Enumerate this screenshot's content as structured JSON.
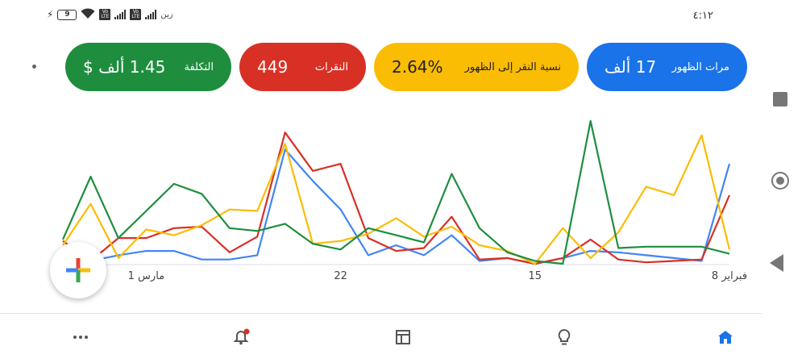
{
  "status_bar": {
    "battery_level": "9",
    "carrier": "زين",
    "time": "٤:١٢",
    "icons": [
      "charging-bolt-icon",
      "battery-icon",
      "wifi-icon",
      "volte-icon",
      "signal-icon"
    ]
  },
  "metric_cards": [
    {
      "id": "impressions",
      "label": "مرات الظهور",
      "value": "17 ألف",
      "color": "#1a73e8"
    },
    {
      "id": "ctr",
      "label": "نسبة النقر إلى الظهور",
      "value": "2.64%",
      "color": "#fbbc04"
    },
    {
      "id": "clicks",
      "label": "النقرات",
      "value": "449",
      "color": "#d93025"
    },
    {
      "id": "cost",
      "label": "التكلفة",
      "value": "1.45 ألف $",
      "color": "#1e8e3e"
    }
  ],
  "chart_data": {
    "type": "line",
    "x_labels": [
      {
        "label": "فبراير 8",
        "index": 0
      },
      {
        "label": "15",
        "index": 7
      },
      {
        "label": "22",
        "index": 14
      },
      {
        "label": "مارس 1",
        "index": 21
      }
    ],
    "ylim": [
      0,
      100
    ],
    "grid": false,
    "x_count": 25,
    "series": [
      {
        "color": "#4285f4",
        "values": [
          70,
          2,
          4,
          6,
          8,
          9,
          4,
          0,
          4,
          2,
          20,
          6,
          13,
          6,
          38,
          58,
          80,
          6,
          3,
          3,
          9,
          9,
          6,
          2,
          5
        ]
      },
      {
        "color": "#d93025",
        "values": [
          48,
          3,
          2,
          1,
          3,
          17,
          4,
          0,
          4,
          3,
          33,
          11,
          9,
          18,
          70,
          65,
          92,
          19,
          8,
          26,
          25,
          18,
          18,
          2,
          16
        ]
      },
      {
        "color": "#fbbc04",
        "values": [
          10,
          90,
          48,
          54,
          22,
          4,
          25,
          0,
          9,
          13,
          26,
          19,
          32,
          21,
          16,
          14,
          84,
          37,
          38,
          27,
          20,
          24,
          4,
          42,
          13
        ]
      },
      {
        "color": "#1e8e3e",
        "values": [
          7,
          12,
          12,
          12,
          11,
          100,
          0,
          2,
          8,
          25,
          63,
          15,
          20,
          25,
          10,
          14,
          28,
          23,
          25,
          49,
          56,
          37,
          18,
          61,
          17
        ]
      }
    ]
  },
  "fab": {
    "icon": "google-plus-icon"
  },
  "bottom_nav": [
    {
      "id": "overview",
      "icon": "home-icon",
      "active": true,
      "color": "#1a73e8"
    },
    {
      "id": "recommendations",
      "icon": "lightbulb-icon",
      "active": false,
      "color": "#555"
    },
    {
      "id": "campaigns",
      "icon": "table-layout-icon",
      "active": false,
      "color": "#555"
    },
    {
      "id": "notifications",
      "icon": "bell-icon",
      "active": false,
      "badge": true,
      "color": "#555"
    },
    {
      "id": "more",
      "icon": "more-icon",
      "active": false,
      "color": "#555"
    }
  ],
  "system_nav": [
    "recents-square-icon",
    "home-circle-icon",
    "back-triangle-icon"
  ]
}
